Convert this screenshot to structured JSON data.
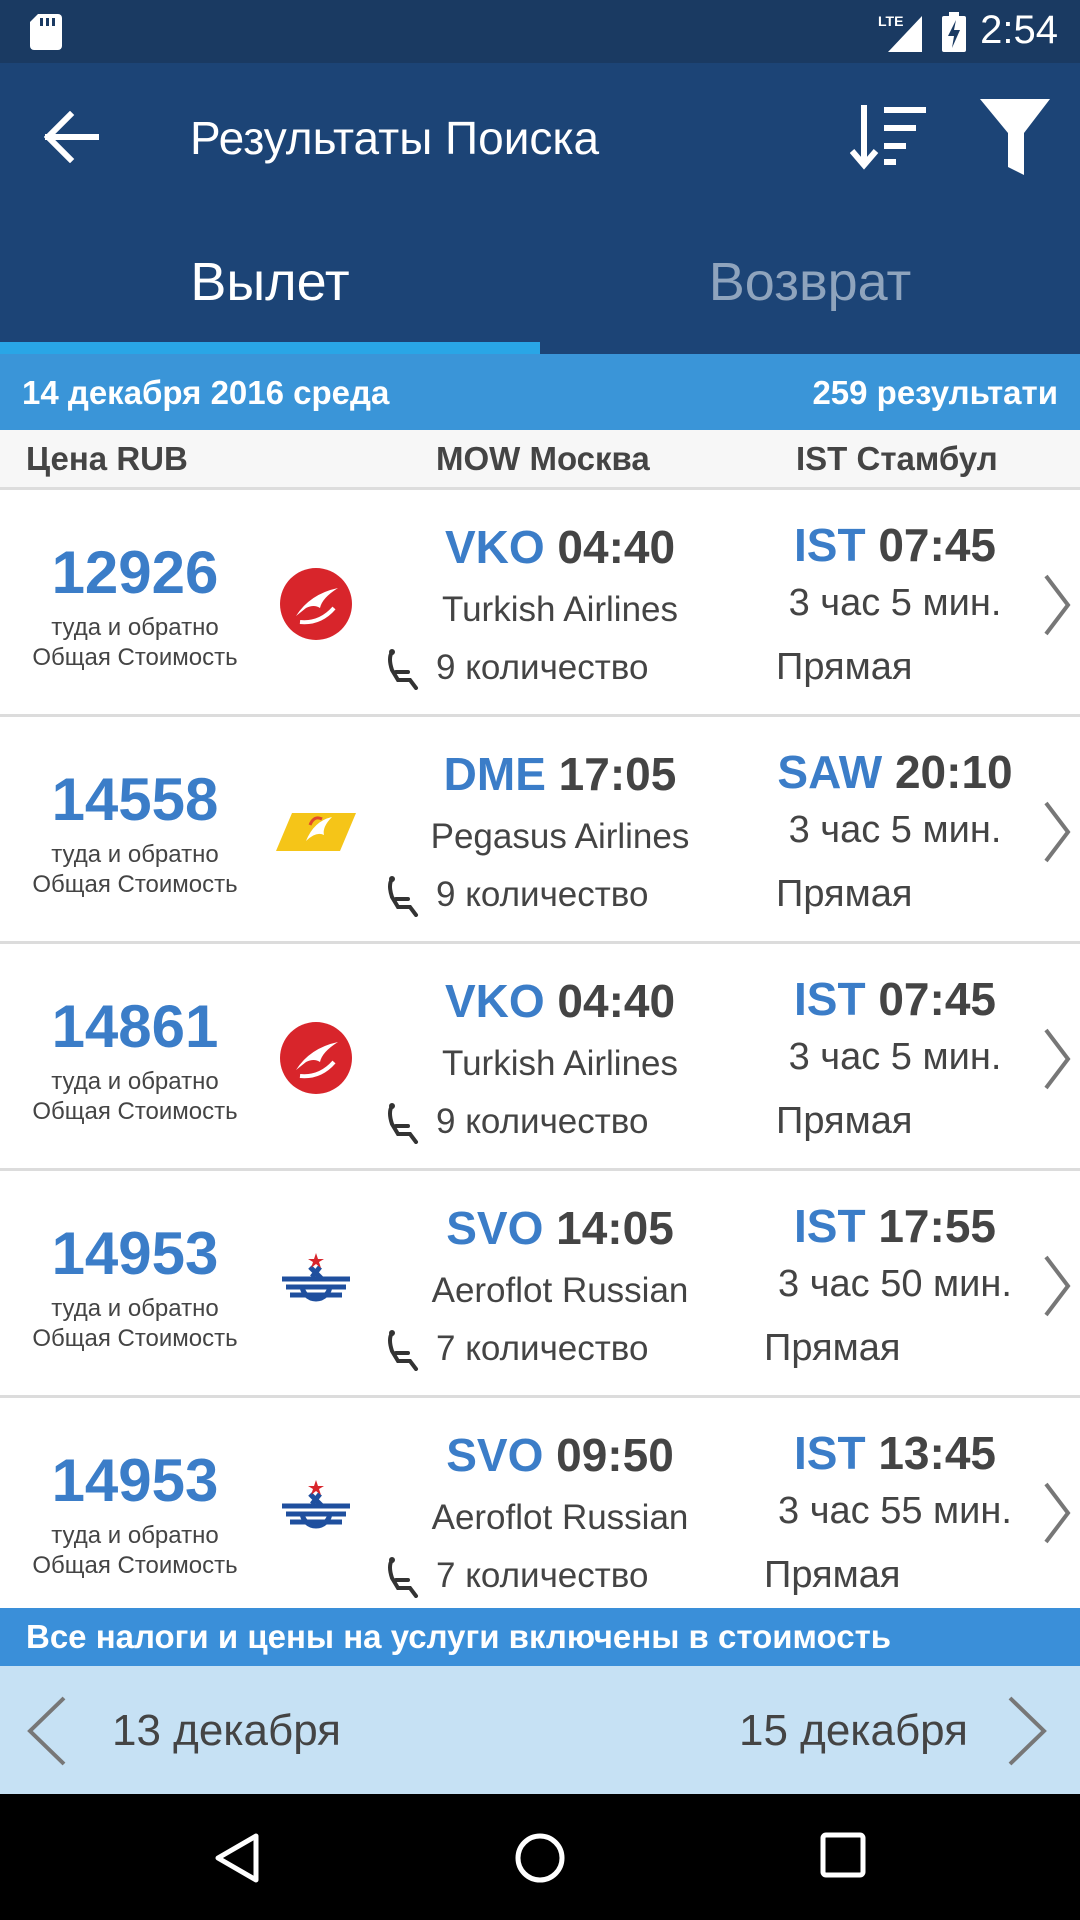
{
  "status_bar": {
    "time": "2:54",
    "network": "LTE"
  },
  "toolbar": {
    "title": "Результаты Поиска"
  },
  "tabs": [
    {
      "label": "Вылет",
      "active": true
    },
    {
      "label": "Возврат",
      "active": false
    }
  ],
  "date_bar": {
    "date": "14 декабря 2016 среда",
    "results": "259 результати"
  },
  "columns": {
    "price": "Цена RUB",
    "from": "MOW Москва",
    "to": "IST Стамбул"
  },
  "colors": {
    "header": "#1c4476",
    "accent": "#3b7dc8",
    "date_bar": "#3a95d8",
    "day_nav": "#c6e1f4"
  },
  "flights": [
    {
      "price": "12926",
      "price_note1": "туда и обратно",
      "price_note2": "Общая Стоимость",
      "logo": "turkish-airlines-logo",
      "dep_code": "VKO",
      "dep_time": "04:40",
      "airline": "Turkish Airlines",
      "seats": "9 количество",
      "arr_code": "IST",
      "arr_time": "07:45",
      "duration": "3 час 5 мин.",
      "stops": "Прямая"
    },
    {
      "price": "14558",
      "price_note1": "туда и обратно",
      "price_note2": "Общая Стоимость",
      "logo": "pegasus-airlines-logo",
      "dep_code": "DME",
      "dep_time": "17:05",
      "airline": "Pegasus Airlines",
      "seats": "9 количество",
      "arr_code": "SAW",
      "arr_time": "20:10",
      "duration": "3 час 5 мин.",
      "stops": "Прямая"
    },
    {
      "price": "14861",
      "price_note1": "туда и обратно",
      "price_note2": "Общая Стоимость",
      "logo": "turkish-airlines-logo",
      "dep_code": "VKO",
      "dep_time": "04:40",
      "airline": "Turkish Airlines",
      "seats": "9 количество",
      "arr_code": "IST",
      "arr_time": "07:45",
      "duration": "3 час 5 мин.",
      "stops": "Прямая"
    },
    {
      "price": "14953",
      "price_note1": "туда и обратно",
      "price_note2": "Общая Стоимость",
      "logo": "aeroflot-logo",
      "dep_code": "SVO",
      "dep_time": "14:05",
      "airline": "Aeroflot Russian",
      "seats": "7 количество",
      "arr_code": "IST",
      "arr_time": "17:55",
      "duration": "3 час 50 мин.",
      "stops": "Прямая"
    },
    {
      "price": "14953",
      "price_note1": "туда и обратно",
      "price_note2": "Общая Стоимость",
      "logo": "aeroflot-logo",
      "dep_code": "SVO",
      "dep_time": "09:50",
      "airline": "Aeroflot Russian",
      "seats": "7 количество",
      "arr_code": "IST",
      "arr_time": "13:45",
      "duration": "3 час 55 мин.",
      "stops": "Прямая"
    }
  ],
  "notice": "Все налоги и цены на услуги включены в стоимость",
  "day_nav": {
    "prev": "13 декабря",
    "next": "15 декабря"
  }
}
